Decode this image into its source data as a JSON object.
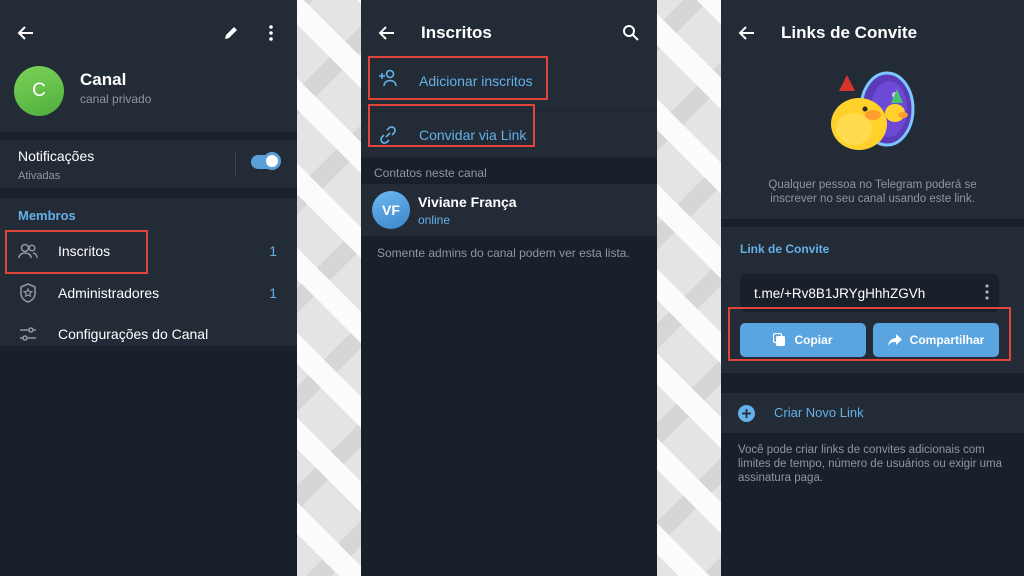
{
  "colors": {
    "accent": "#64b1ea",
    "panel": "#232b36",
    "background": "#1a2029",
    "highlight": "#e0443a",
    "button": "#5aa5e0"
  },
  "screen1": {
    "channel_name": "Canal",
    "channel_type": "canal privado",
    "avatar_letter": "C",
    "notifications": {
      "title": "Notificações",
      "status": "Ativadas",
      "enabled": true
    },
    "members_title": "Membros",
    "menu": [
      {
        "label": "Inscritos",
        "count": "1",
        "icon": "people-icon"
      },
      {
        "label": "Administradores",
        "count": "1",
        "icon": "shield-star-icon"
      },
      {
        "label": "Configurações do Canal",
        "count": "",
        "icon": "sliders-icon"
      }
    ]
  },
  "screen2": {
    "title": "Inscritos",
    "actions": [
      {
        "label": "Adicionar inscritos",
        "icon": "add-user-icon"
      },
      {
        "label": "Convidar via Link",
        "icon": "link-icon"
      }
    ],
    "contacts_header": "Contatos neste canal",
    "contact": {
      "initials": "VF",
      "name": "Viviane França",
      "status": "online"
    },
    "admins_note": "Somente admins do canal podem ver esta lista."
  },
  "screen3": {
    "title": "Links de Convite",
    "description": "Qualquer pessoa no Telegram poderá se inscrever no seu canal usando este link.",
    "link_title": "Link de Convite",
    "link": "t.me/+Rv8B1JRYgHhhZGVh",
    "copy_label": "Copiar",
    "share_label": "Compartilhar",
    "new_link_label": "Criar Novo Link",
    "bottom_note": "Você pode criar links de convites adicionais com limites de tempo, número de usuários ou exigir uma assinatura paga."
  }
}
